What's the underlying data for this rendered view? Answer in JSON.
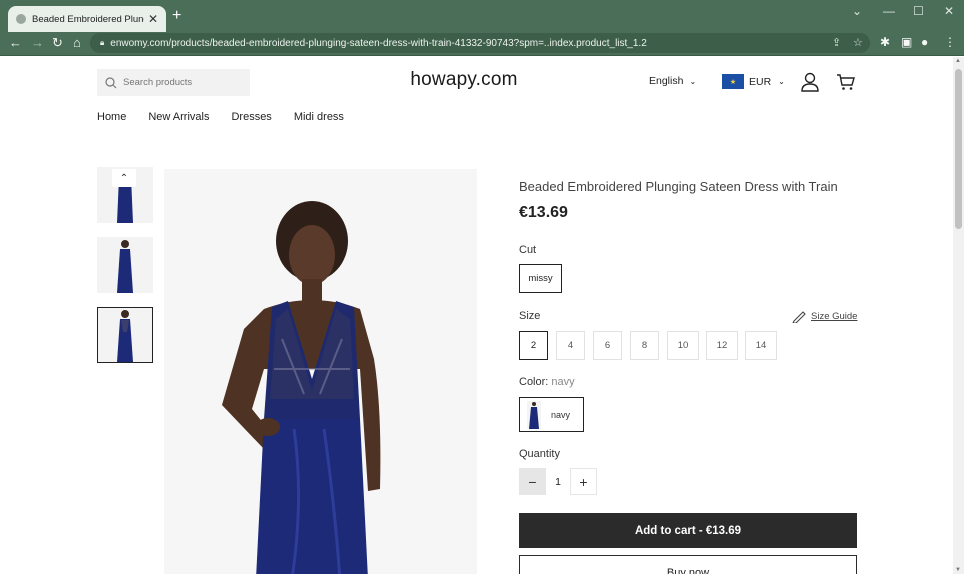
{
  "browser": {
    "tab_title": "Beaded Embroidered Plunging Sa",
    "url": "enwomy.com/products/beaded-embroidered-plunging-sateen-dress-with-train-41332-90743?spm=..index.product_list_1.2",
    "new_tab_label": "+"
  },
  "header": {
    "search_placeholder": "Search products",
    "logo": "howapy.com",
    "language": "English",
    "currency": "EUR"
  },
  "nav": {
    "items": [
      {
        "label": "Home"
      },
      {
        "label": "New Arrivals"
      },
      {
        "label": "Dresses"
      },
      {
        "label": "Midi dress"
      }
    ]
  },
  "product": {
    "title": "Beaded Embroidered Plunging Sateen Dress with Train",
    "price": "€13.69",
    "cut_label": "Cut",
    "cut_value": "missy",
    "size_label": "Size",
    "size_guide": "Size Guide",
    "sizes": [
      "2",
      "4",
      "6",
      "8",
      "10",
      "12",
      "14"
    ],
    "selected_size": "2",
    "color_label": "Color:",
    "color_value": "navy",
    "color_option": "navy",
    "quantity_label": "Quantity",
    "quantity": "1",
    "add_to_cart": "Add to cart - €13.69",
    "buy_now": "Buy now"
  },
  "colors": {
    "chrome": "#4b6e58",
    "button_dark": "#2b2b2b",
    "dress_navy": "#1c2a78"
  }
}
